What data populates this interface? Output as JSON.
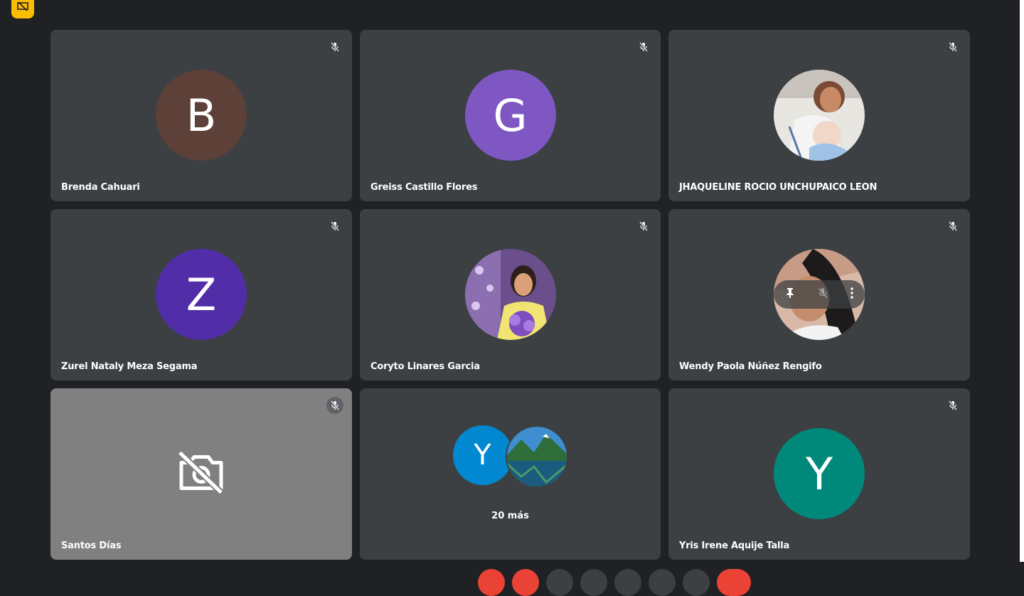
{
  "top_badge": {
    "icon": "screen-share-off-icon",
    "color": "#fbbc04"
  },
  "participants": [
    {
      "name": "Brenda Cahuari",
      "initial": "B",
      "color": "#5d4037",
      "muted": true
    },
    {
      "name": "Greiss Castillo Flores",
      "initial": "G",
      "color": "#7e57c2",
      "muted": true
    },
    {
      "name": "JHAQUELINE ROCIO UNCHUPAICO LEON",
      "initial": "",
      "photo": true,
      "muted": true
    },
    {
      "name": "Zurel Nataly Meza Segama",
      "initial": "Z",
      "color": "#512da8",
      "muted": true
    },
    {
      "name": "Coryto Linares Garcia",
      "initial": "",
      "photo": true,
      "muted": true
    },
    {
      "name": "Wendy Paola Núñez Rengifo",
      "initial": "",
      "photo": true,
      "muted": true
    },
    {
      "name": "Santos Días",
      "camera_off": true,
      "muted": true
    },
    {
      "more": true
    },
    {
      "name": "Yris Irene Aquije Talla",
      "initial": "Y",
      "color": "#00897b",
      "muted": true
    }
  ],
  "more_tile": {
    "initial": "Y",
    "color": "#0288d1",
    "label": "20 más"
  }
}
